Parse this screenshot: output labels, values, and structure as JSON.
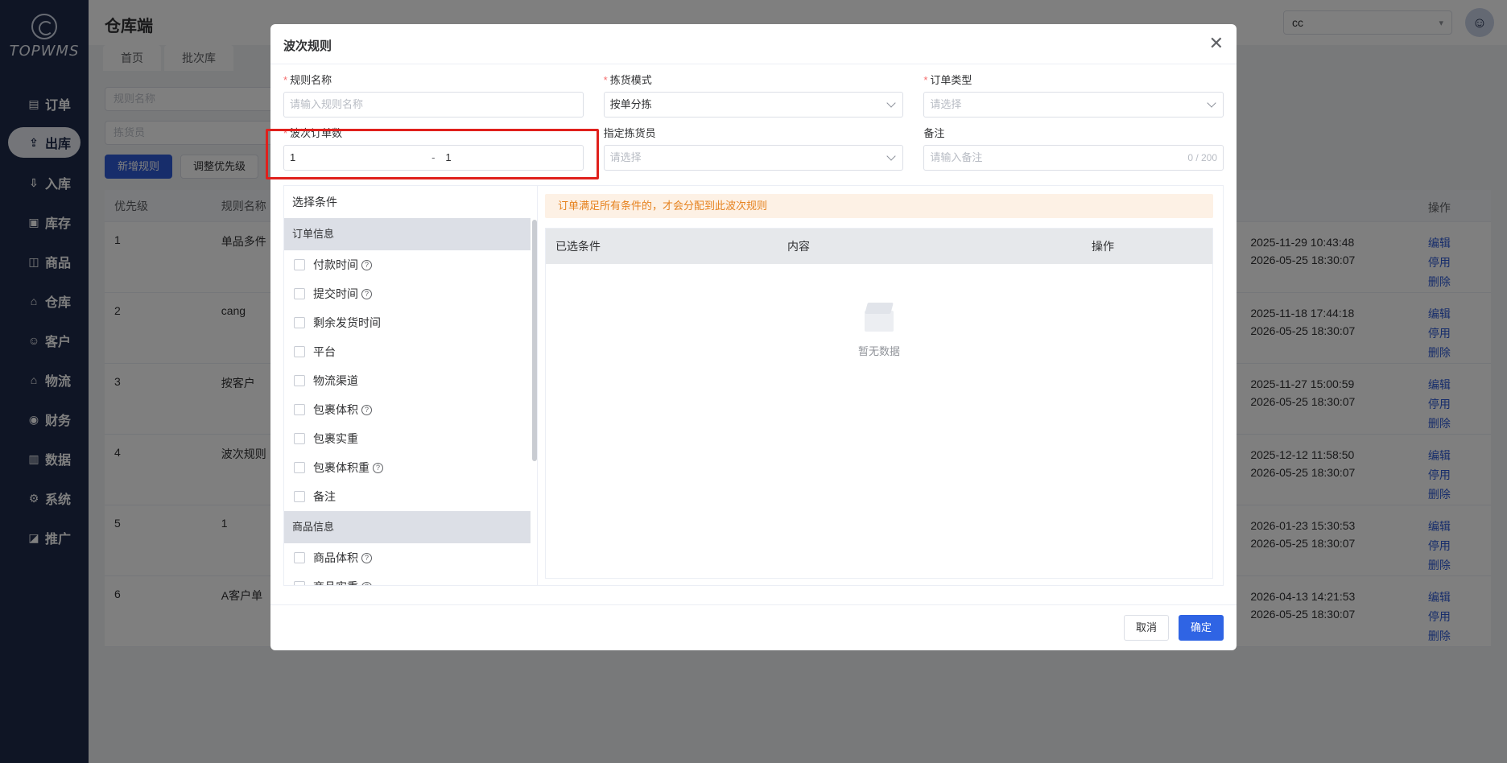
{
  "app": {
    "logo_text": "TOPWMS",
    "title": "仓库端"
  },
  "sidebar": {
    "items": [
      {
        "label": "订单",
        "icon": "order-icon"
      },
      {
        "label": "出库",
        "icon": "outbound-icon",
        "active": true
      },
      {
        "label": "入库",
        "icon": "inbound-icon"
      },
      {
        "label": "库存",
        "icon": "inventory-icon"
      },
      {
        "label": "商品",
        "icon": "product-icon"
      },
      {
        "label": "仓库",
        "icon": "warehouse-icon"
      },
      {
        "label": "客户",
        "icon": "customer-icon"
      },
      {
        "label": "物流",
        "icon": "logistics-icon"
      },
      {
        "label": "财务",
        "icon": "finance-icon"
      },
      {
        "label": "数据",
        "icon": "data-icon"
      },
      {
        "label": "系统",
        "icon": "system-icon"
      },
      {
        "label": "推广",
        "icon": "promotion-icon"
      }
    ]
  },
  "header": {
    "user_select_value": "cc"
  },
  "page_tabs": [
    "首页",
    "批次库"
  ],
  "background": {
    "filters": {
      "rule_name_placeholder": "规则名称",
      "picker_placeholder": "拣货员"
    },
    "buttons": {
      "add_rule": "新增规则",
      "adjust_priority": "调整优先级"
    },
    "table": {
      "headers": {
        "priority": "优先级",
        "rule_name": "规则名称",
        "ops": "操作"
      },
      "rows": [
        {
          "priority": "1",
          "name": "单品多件",
          "t1": "2025-11-29 10:43:48",
          "t2": "2026-05-25 18:30:07"
        },
        {
          "priority": "2",
          "name": "cang",
          "t1": "2025-11-18 17:44:18",
          "t2": "2026-05-25 18:30:07"
        },
        {
          "priority": "3",
          "name": "按客户",
          "t1": "2025-11-27 15:00:59",
          "t2": "2026-05-25 18:30:07"
        },
        {
          "priority": "4",
          "name": "波次规则",
          "t1": "2025-12-12 11:58:50",
          "t2": "2026-05-25 18:30:07"
        },
        {
          "priority": "5",
          "name": "1",
          "t1": "2026-01-23 15:30:53",
          "t2": "2026-05-25 18:30:07"
        },
        {
          "priority": "6",
          "name": "A客户单",
          "t1": "2026-04-13 14:21:53",
          "t2": "2026-05-25 18:30:07"
        }
      ],
      "op_labels": {
        "edit": "编辑",
        "disable": "停用",
        "delete": "删除"
      }
    }
  },
  "modal": {
    "title": "波次规则",
    "fields": {
      "rule_name": {
        "label": "规则名称",
        "placeholder": "请输入规则名称",
        "required": true
      },
      "pick_mode": {
        "label": "拣货模式",
        "value": "按单分拣",
        "required": true
      },
      "order_type": {
        "label": "订单类型",
        "placeholder": "请选择",
        "required": true
      },
      "wave_order_count": {
        "label": "波次订单数",
        "min": "1",
        "sep": "-",
        "max": "1",
        "required": true
      },
      "assigned_picker": {
        "label": "指定拣货员",
        "placeholder": "请选择"
      },
      "remark": {
        "label": "备注",
        "placeholder": "请输入备注",
        "counter": "0 / 200"
      }
    },
    "conditions": {
      "title": "选择条件",
      "groups": [
        {
          "name": "订单信息",
          "items": [
            {
              "label": "付款时间",
              "help": true
            },
            {
              "label": "提交时间",
              "help": true
            },
            {
              "label": "剩余发货时间",
              "help": false
            },
            {
              "label": "平台",
              "help": false
            },
            {
              "label": "物流渠道",
              "help": false
            },
            {
              "label": "包裹体积",
              "help": true
            },
            {
              "label": "包裹实重",
              "help": false
            },
            {
              "label": "包裹体积重",
              "help": true
            },
            {
              "label": "备注",
              "help": false
            }
          ]
        },
        {
          "name": "商品信息",
          "items": [
            {
              "label": "商品体积",
              "help": true
            },
            {
              "label": "商品实重",
              "help": true
            }
          ]
        }
      ]
    },
    "notice": "订单满足所有条件的，才会分配到此波次规则",
    "selected_table": {
      "headers": {
        "selected": "已选条件",
        "content": "内容",
        "ops": "操作"
      },
      "empty_text": "暂无数据"
    },
    "footer": {
      "cancel": "取消",
      "confirm": "确定"
    }
  }
}
